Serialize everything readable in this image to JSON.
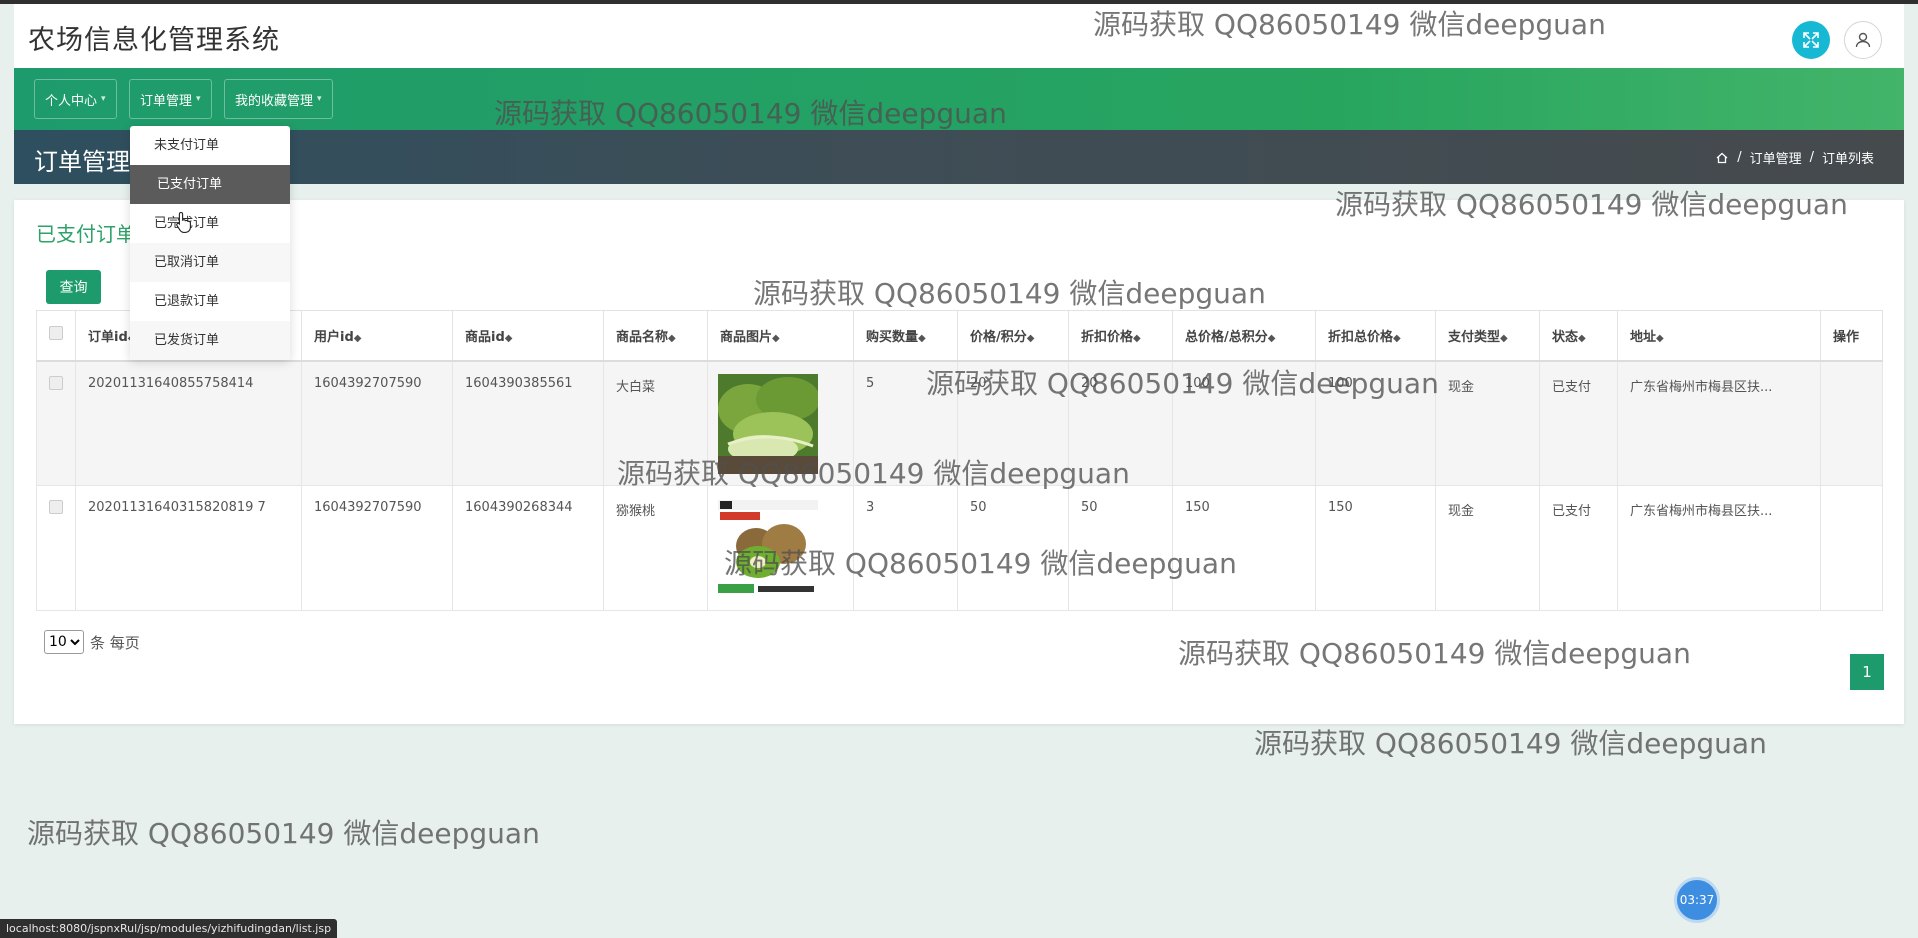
{
  "app": {
    "title": "农场信息化管理系统"
  },
  "nav": [
    {
      "label": "个人中心"
    },
    {
      "label": "订单管理"
    },
    {
      "label": "我的收藏管理"
    }
  ],
  "dropdown": [
    {
      "label": "未支付订单"
    },
    {
      "label": "已支付订单"
    },
    {
      "label": "已完成订单"
    },
    {
      "label": "已取消订单"
    },
    {
      "label": "已退款订单"
    },
    {
      "label": "已发货订单"
    }
  ],
  "band": {
    "title": "订单管理"
  },
  "breadcrumb": [
    "订单管理",
    "订单列表"
  ],
  "card": {
    "title": "已支付订单",
    "query_label": "查询"
  },
  "table": {
    "columns": [
      "订单id",
      "用户id",
      "商品id",
      "商品名称",
      "商品图片",
      "购买数量",
      "价格/积分",
      "折扣价格",
      "总价格/总积分",
      "折扣总价格",
      "支付类型",
      "状态",
      "地址",
      "操作"
    ],
    "rows": [
      {
        "order_id": "20201131640855758414",
        "user_id": "1604392707590",
        "product_id": "1604390385561",
        "name": "大白菜",
        "image": "cabbage",
        "qty": "5",
        "price": "20",
        "discount_price": "20",
        "total": "100",
        "discount_total": "100",
        "pay_type": "现金",
        "status": "已支付",
        "address": "广东省梅州市梅县区扶..."
      },
      {
        "order_id": "20201131640315820819 7",
        "user_id": "1604392707590",
        "product_id": "1604390268344",
        "name": "猕猴桃",
        "image": "kiwi",
        "qty": "3",
        "price": "50",
        "discount_price": "50",
        "total": "150",
        "discount_total": "150",
        "pay_type": "现金",
        "status": "已支付",
        "address": "广东省梅州市梅县区扶..."
      }
    ]
  },
  "pager": {
    "page_size": "10",
    "per_page_label": "条 每页",
    "current_page": "1"
  },
  "watermark": "源码获取 QQ86050149 微信deepguan",
  "timer": "03:37",
  "status_url": "localhost:8080/jspnxRul/jsp/modules/yizhifudingdan/list.jsp",
  "colors": {
    "primary": "#1e9b6c",
    "band": "#3e4d56",
    "accent": "#17b8d4"
  }
}
